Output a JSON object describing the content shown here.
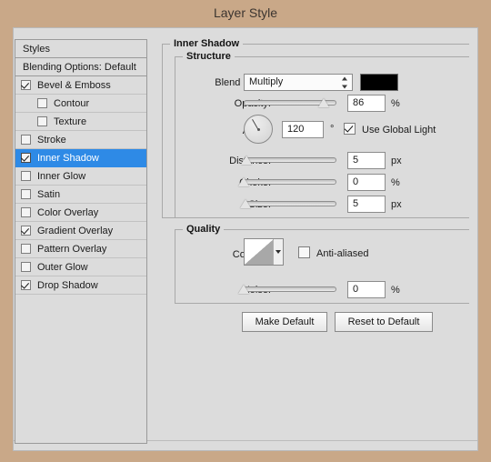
{
  "window": {
    "title": "Layer Style",
    "accent_selection": "#2e8ae6",
    "chrome_color": "#c9a888",
    "dialog_bg": "#dcdcdc"
  },
  "styles_panel": {
    "header": "Styles",
    "blending_options": "Blending Options: Default",
    "items": [
      {
        "label": "Bevel & Emboss",
        "checked": true,
        "indent": false,
        "selected": false
      },
      {
        "label": "Contour",
        "checked": false,
        "indent": true,
        "selected": false
      },
      {
        "label": "Texture",
        "checked": false,
        "indent": true,
        "selected": false
      },
      {
        "label": "Stroke",
        "checked": false,
        "indent": false,
        "selected": false
      },
      {
        "label": "Inner Shadow",
        "checked": true,
        "indent": false,
        "selected": true
      },
      {
        "label": "Inner Glow",
        "checked": false,
        "indent": false,
        "selected": false
      },
      {
        "label": "Satin",
        "checked": false,
        "indent": false,
        "selected": false
      },
      {
        "label": "Color Overlay",
        "checked": false,
        "indent": false,
        "selected": false
      },
      {
        "label": "Gradient Overlay",
        "checked": true,
        "indent": false,
        "selected": false
      },
      {
        "label": "Pattern Overlay",
        "checked": false,
        "indent": false,
        "selected": false
      },
      {
        "label": "Outer Glow",
        "checked": false,
        "indent": false,
        "selected": false
      },
      {
        "label": "Drop Shadow",
        "checked": true,
        "indent": false,
        "selected": false
      }
    ]
  },
  "panel": {
    "group_title": "Inner Shadow",
    "structure": {
      "title": "Structure",
      "blend_mode": {
        "label": "Blend Mode:",
        "value": "Multiply"
      },
      "color": {
        "value": "#000000"
      },
      "opacity": {
        "label": "Opacity:",
        "value": "86",
        "unit": "%",
        "percent": 86
      },
      "angle": {
        "label": "Angle:",
        "value": "120",
        "unit": "°",
        "degrees": 120
      },
      "use_global_light": {
        "label": "Use Global Light",
        "checked": true
      },
      "distance": {
        "label": "Distance:",
        "value": "5",
        "unit": "px",
        "percent": 3
      },
      "choke": {
        "label": "Choke:",
        "value": "0",
        "unit": "%",
        "percent": 0
      },
      "size": {
        "label": "Size:",
        "value": "5",
        "unit": "px",
        "percent": 2
      }
    },
    "quality": {
      "title": "Quality",
      "contour": {
        "label": "Contour:"
      },
      "anti_aliased": {
        "label": "Anti-aliased",
        "checked": false
      },
      "noise": {
        "label": "Noise:",
        "value": "0",
        "unit": "%",
        "percent": 0
      }
    },
    "buttons": {
      "make_default": "Make Default",
      "reset_to_default": "Reset to Default"
    }
  }
}
